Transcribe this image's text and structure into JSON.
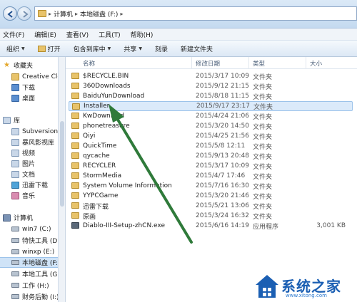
{
  "address": {
    "crumbs": [
      "计算机",
      "本地磁盘 (F:)"
    ]
  },
  "menu": [
    "文件(F)",
    "编辑(E)",
    "查看(V)",
    "工具(T)",
    "帮助(H)"
  ],
  "toolbar": {
    "organize": "组织",
    "open": "打开",
    "include_library": "包含到库中",
    "share": "共享",
    "burn": "刻录",
    "new_folder": "新建文件夹"
  },
  "sidebar": {
    "favorites": "收藏夹",
    "fav_items": [
      "Creative Clo",
      "下载",
      "桌面"
    ],
    "libraries": "库",
    "lib_items": [
      "Subversion",
      "暴风影视库",
      "视频",
      "图片",
      "文档",
      "迅雷下载",
      "音乐"
    ],
    "computer": "计算机",
    "drives": [
      "win7 (C:)",
      "特快工具 (D:",
      "winxp (E:)",
      "本地磁盘 (F:)",
      "本地工具 (G:",
      "工作 (H:)",
      "财务后勤 (I:)"
    ]
  },
  "columns": {
    "name": "名称",
    "date": "修改日期",
    "type": "类型",
    "size": "大小"
  },
  "files": [
    {
      "name": "$RECYCLE.BIN",
      "date": "2015/3/17 10:09",
      "type": "文件夹",
      "size": ""
    },
    {
      "name": "360Downloads",
      "date": "2015/9/12 21:15",
      "type": "文件夹",
      "size": ""
    },
    {
      "name": "BaiduYunDownload",
      "date": "2015/8/18 11:15",
      "type": "文件夹",
      "size": ""
    },
    {
      "name": "Installer",
      "date": "2015/9/17 23:17",
      "type": "文件夹",
      "size": ""
    },
    {
      "name": "KwDownload",
      "date": "2015/4/24 21:06",
      "type": "文件夹",
      "size": ""
    },
    {
      "name": "phonetreasure",
      "date": "2015/3/20 14:50",
      "type": "文件夹",
      "size": ""
    },
    {
      "name": "Qiyi",
      "date": "2015/4/25 21:56",
      "type": "文件夹",
      "size": ""
    },
    {
      "name": "QuickTime",
      "date": "2015/5/8 12:11",
      "type": "文件夹",
      "size": ""
    },
    {
      "name": "qycache",
      "date": "2015/9/13 20:48",
      "type": "文件夹",
      "size": ""
    },
    {
      "name": "RECYCLER",
      "date": "2015/3/17 10:09",
      "type": "文件夹",
      "size": ""
    },
    {
      "name": "StormMedia",
      "date": "2015/4/7 17:46",
      "type": "文件夹",
      "size": ""
    },
    {
      "name": "System Volume Information",
      "date": "2015/7/16 16:30",
      "type": "文件夹",
      "size": ""
    },
    {
      "name": "YYPCGame",
      "date": "2015/3/20 21:46",
      "type": "文件夹",
      "size": ""
    },
    {
      "name": "迅雷下载",
      "date": "2015/5/21 13:06",
      "type": "文件夹",
      "size": ""
    },
    {
      "name": "原画",
      "date": "2015/3/24 16:32",
      "type": "文件夹",
      "size": ""
    },
    {
      "name": "Diablo-III-Setup-zhCN.exe",
      "date": "2015/6/16 14:19",
      "type": "应用程序",
      "size": "3,001 KB"
    }
  ],
  "selected_index": 3,
  "watermark": {
    "text": "系统之家",
    "url": "www.xitong.com"
  },
  "colors": {
    "arrow": "#2f7a3a",
    "selection": "#dbeafa"
  }
}
